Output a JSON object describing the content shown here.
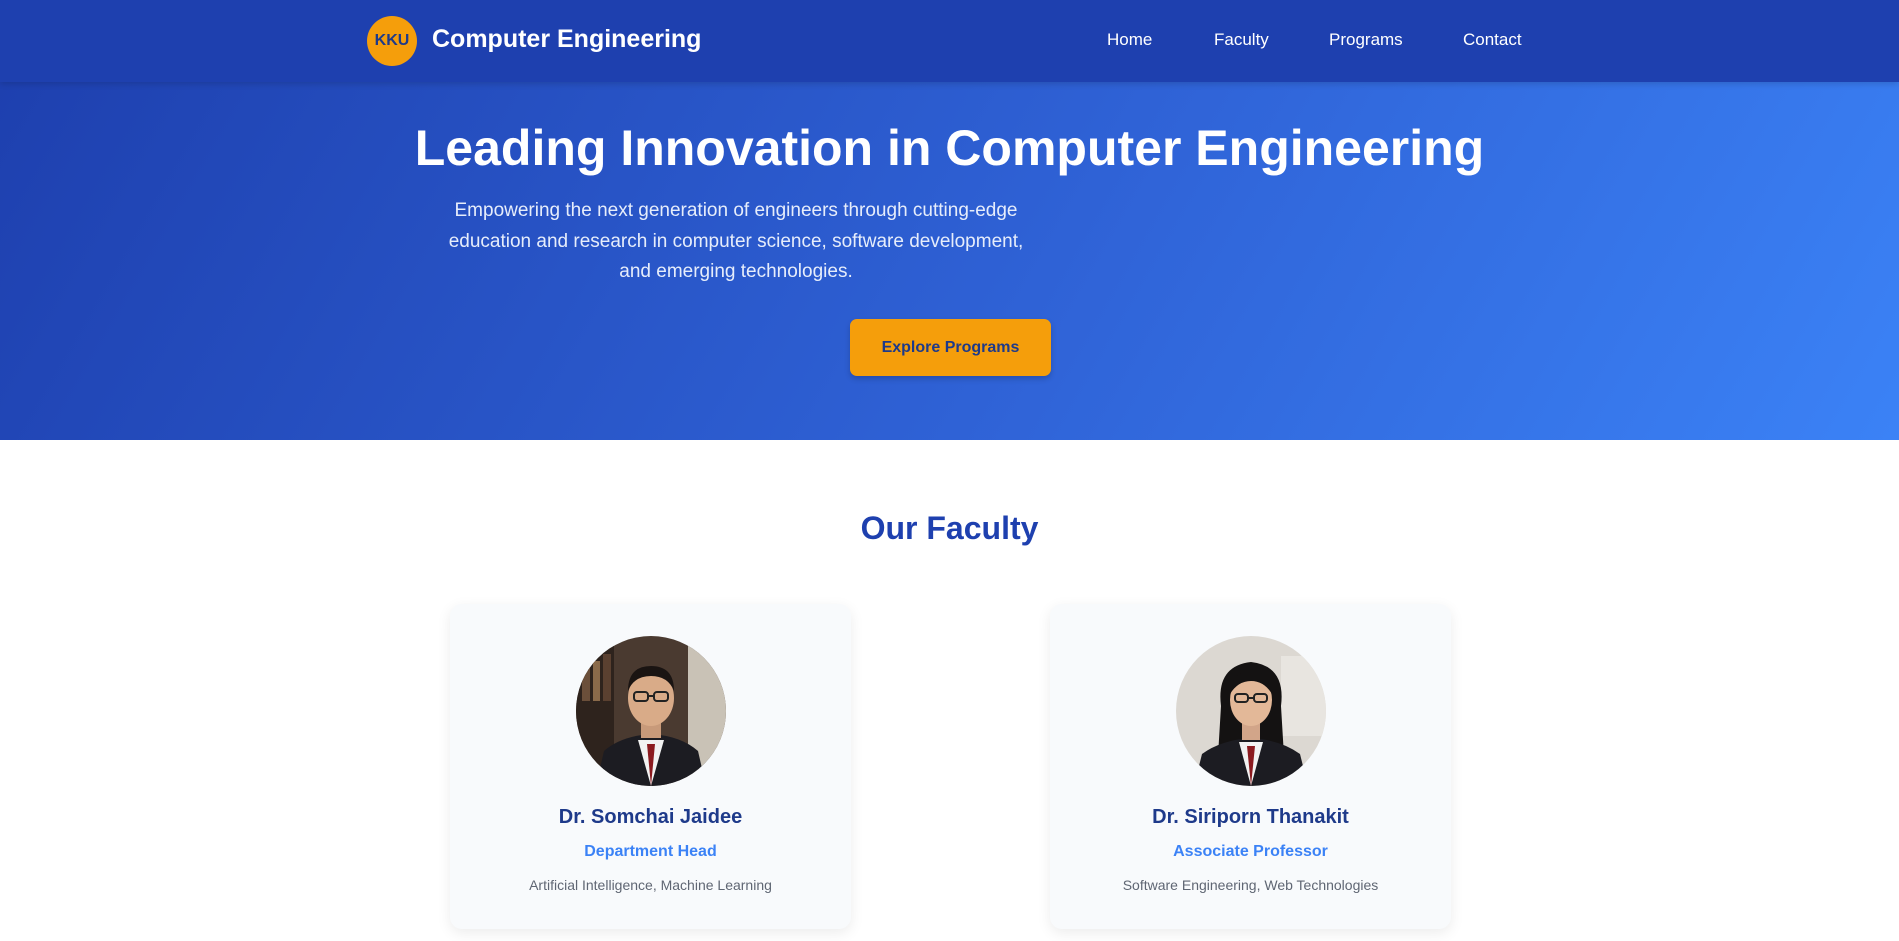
{
  "navbar": {
    "logo_text": "KKU",
    "title": "Computer Engineering",
    "links": [
      "Home",
      "Faculty",
      "Programs",
      "Contact"
    ]
  },
  "hero": {
    "title": "Leading Innovation in Computer Engineering",
    "subtitle": "Empowering the next generation of engineers through cutting-edge education and research in computer science, software development, and emerging technologies.",
    "cta_label": "Explore Programs"
  },
  "faculty": {
    "heading": "Our Faculty",
    "members": [
      {
        "name": "Dr. Somchai Jaidee",
        "role": "Department Head",
        "areas": "Artificial Intelligence, Machine Learning",
        "photo_icon": "faculty-photo-man"
      },
      {
        "name": "Dr. Siriporn Thanakit",
        "role": "Associate Professor",
        "areas": "Software Engineering, Web Technologies",
        "photo_icon": "faculty-photo-woman"
      }
    ]
  },
  "colors": {
    "primary": "#1e40af",
    "accent": "#f59e0b",
    "light_blue": "#3b82f6"
  }
}
